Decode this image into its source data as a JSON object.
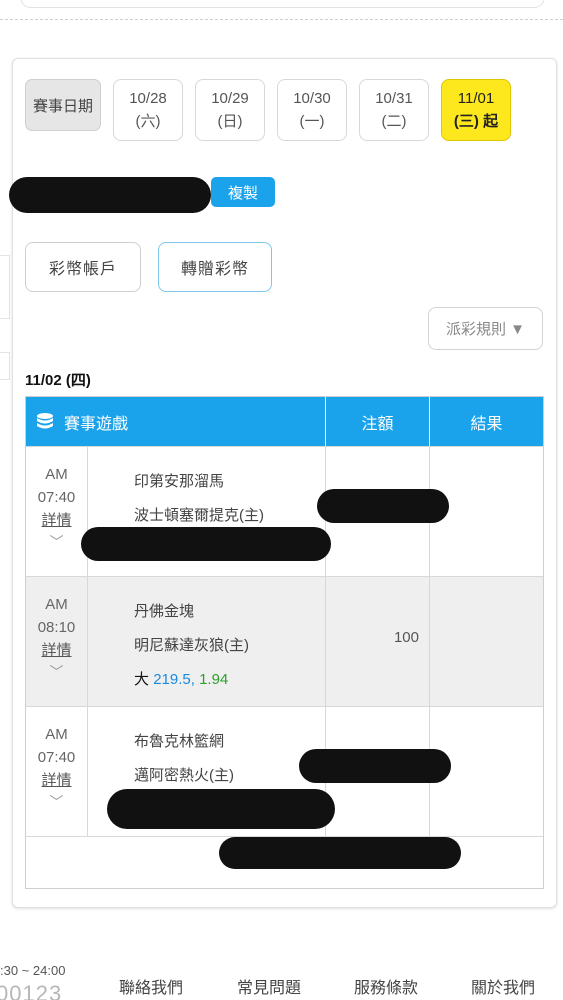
{
  "dates": {
    "label": "賽事日期",
    "items": [
      {
        "line1": "10/28",
        "line2": "(六)"
      },
      {
        "line1": "10/29",
        "line2": "(日)"
      },
      {
        "line1": "10/30",
        "line2": "(一)"
      },
      {
        "line1": "10/31",
        "line2": "(二)"
      },
      {
        "line1": "11/01",
        "line2": "(三) 起"
      }
    ],
    "active_index": 4
  },
  "copy_label": "複製",
  "buttons": {
    "account": "彩幣帳戶",
    "transfer": "轉贈彩幣"
  },
  "rules_label": "派彩規則 ▼",
  "section_date": "11/02 (四)",
  "table": {
    "headers": {
      "game": "賽事遊戲",
      "stake": "注額",
      "result": "結果"
    },
    "rows": [
      {
        "ampm": "AM",
        "time": "07:40",
        "detail": "詳情",
        "team1": "印第安那溜馬",
        "team2": "波士頓塞爾提克(主)",
        "stake": "",
        "pick_side": "",
        "pick_line": "",
        "pick_odds": ""
      },
      {
        "ampm": "AM",
        "time": "08:10",
        "detail": "詳情",
        "team1": "丹佛金塊",
        "team2": "明尼蘇達灰狼(主)",
        "stake": "100",
        "pick_side": "大",
        "pick_line": "219.5,",
        "pick_odds": "1.94"
      },
      {
        "ampm": "AM",
        "time": "07:40",
        "detail": "詳情",
        "team1": "布魯克林籃網",
        "team2": "邁阿密熱火(主)",
        "stake": "",
        "pick_side": "",
        "pick_line": "",
        "pick_odds": ""
      }
    ]
  },
  "footer": {
    "hours": ":30 ~ 24:00",
    "number": "00123",
    "links": [
      "聯絡我們",
      "常見問題",
      "服務條款",
      "關於我們"
    ]
  },
  "colors": {
    "accent": "#1aa2ea",
    "active_date": "#fce81d",
    "line_blue": "#1a8ae0",
    "odds_green": "#2aa02a"
  }
}
